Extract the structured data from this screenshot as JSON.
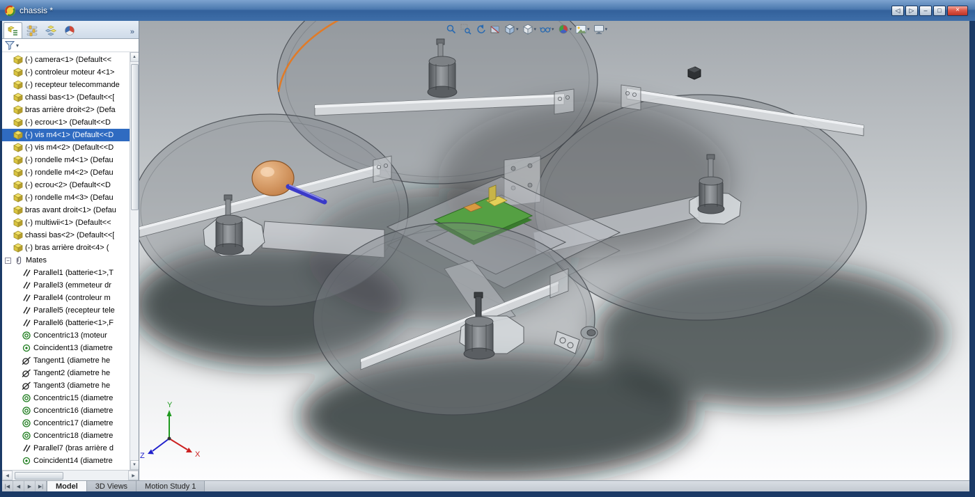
{
  "window": {
    "title": "chassis *",
    "controls": {
      "prev": "◁",
      "next": "▷",
      "minimize": "–",
      "restore": "□",
      "close": "×"
    }
  },
  "glyphs": {
    "minus": "−",
    "chevrons": "»",
    "caret": "▾",
    "up": "▲",
    "down": "▼",
    "left": "◀",
    "right": "▶"
  },
  "panel": {
    "tabs": [
      "feature-manager",
      "property-manager",
      "configuration-manager",
      "display-manager"
    ],
    "tree": {
      "selected_index": 6,
      "items": [
        {
          "icon": "component",
          "label": "(-) camera<1> (Default<<"
        },
        {
          "icon": "component",
          "label": "(-) controleur moteur 4<1>"
        },
        {
          "icon": "component",
          "label": "(-) recepteur telecommande"
        },
        {
          "icon": "component",
          "label": "chassi bas<1> (Default<<["
        },
        {
          "icon": "component",
          "label": "bras arrière droit<2> (Defa"
        },
        {
          "icon": "component",
          "label": "(-) ecrou<1> (Default<<D"
        },
        {
          "icon": "component",
          "label": "(-) vis m4<1> (Default<<D"
        },
        {
          "icon": "component",
          "label": "(-) vis m4<2> (Default<<D"
        },
        {
          "icon": "component",
          "label": "(-) rondelle m4<1> (Defau"
        },
        {
          "icon": "component",
          "label": "(-) rondelle m4<2> (Defau"
        },
        {
          "icon": "component",
          "label": "(-) ecrou<2> (Default<<D"
        },
        {
          "icon": "component",
          "label": "(-) rondelle m4<3> (Defau"
        },
        {
          "icon": "component",
          "label": "bras avant droit<1> (Defau"
        },
        {
          "icon": "component",
          "label": "(-) multiwii<1> (Default<<"
        },
        {
          "icon": "component",
          "label": "chassi bas<2> (Default<<["
        },
        {
          "icon": "component",
          "label": "(-) bras arrière droit<4> ("
        }
      ],
      "mates": {
        "label": "Mates",
        "children": [
          {
            "icon": "parallel",
            "label": "Parallel1 (batterie<1>,T"
          },
          {
            "icon": "parallel",
            "label": "Parallel3 (emmeteur dr"
          },
          {
            "icon": "parallel",
            "label": "Parallel4 (controleur m"
          },
          {
            "icon": "parallel",
            "label": "Parallel5 (recepteur tele"
          },
          {
            "icon": "parallel",
            "label": "Parallel6 (batterie<1>,F"
          },
          {
            "icon": "concentric",
            "label": "Concentric13 (moteur"
          },
          {
            "icon": "coincident",
            "label": "Coincident13 (diametre"
          },
          {
            "icon": "tangent",
            "label": "Tangent1 (diametre he"
          },
          {
            "icon": "tangent",
            "label": "Tangent2 (diametre he"
          },
          {
            "icon": "tangent",
            "label": "Tangent3 (diametre he"
          },
          {
            "icon": "concentric",
            "label": "Concentric15 (diametre"
          },
          {
            "icon": "concentric",
            "label": "Concentric16 (diametre"
          },
          {
            "icon": "concentric",
            "label": "Concentric17 (diametre"
          },
          {
            "icon": "concentric",
            "label": "Concentric18 (diametre"
          },
          {
            "icon": "parallel",
            "label": "Parallel7 (bras arrière d"
          },
          {
            "icon": "coincident",
            "label": "Coincident14 (diametre"
          }
        ]
      }
    }
  },
  "viewport_toolbar": {
    "items": [
      {
        "name": "zoom-to-fit",
        "dropdown": false
      },
      {
        "name": "zoom-to-area",
        "dropdown": false
      },
      {
        "name": "previous-view",
        "dropdown": false
      },
      {
        "name": "section-view",
        "dropdown": false
      },
      {
        "name": "view-orientation",
        "dropdown": true
      },
      {
        "name": "display-style",
        "dropdown": true
      },
      {
        "name": "hide-show-items",
        "dropdown": true
      },
      {
        "name": "edit-appearance",
        "dropdown": true
      },
      {
        "name": "apply-scene",
        "dropdown": true
      },
      {
        "name": "view-settings",
        "dropdown": true
      }
    ]
  },
  "triad": {
    "x": "X",
    "y": "Y",
    "z": "Z"
  },
  "doc_tabs": {
    "nav": [
      "|◀",
      "◀",
      "▶",
      "▶|"
    ],
    "tabs": [
      {
        "label": "Model",
        "active": true
      },
      {
        "label": "3D Views",
        "active": false
      },
      {
        "label": "Motion Study 1",
        "active": false
      }
    ]
  },
  "colors": {
    "titlebar_blue": "#3f6fae",
    "selection_blue": "#2f6bc1",
    "highlight_orange": "#e07b28",
    "board_green": "#55a043",
    "selected_screw_blue": "#3a3ac8",
    "frame_navy": "#1b3a66"
  }
}
